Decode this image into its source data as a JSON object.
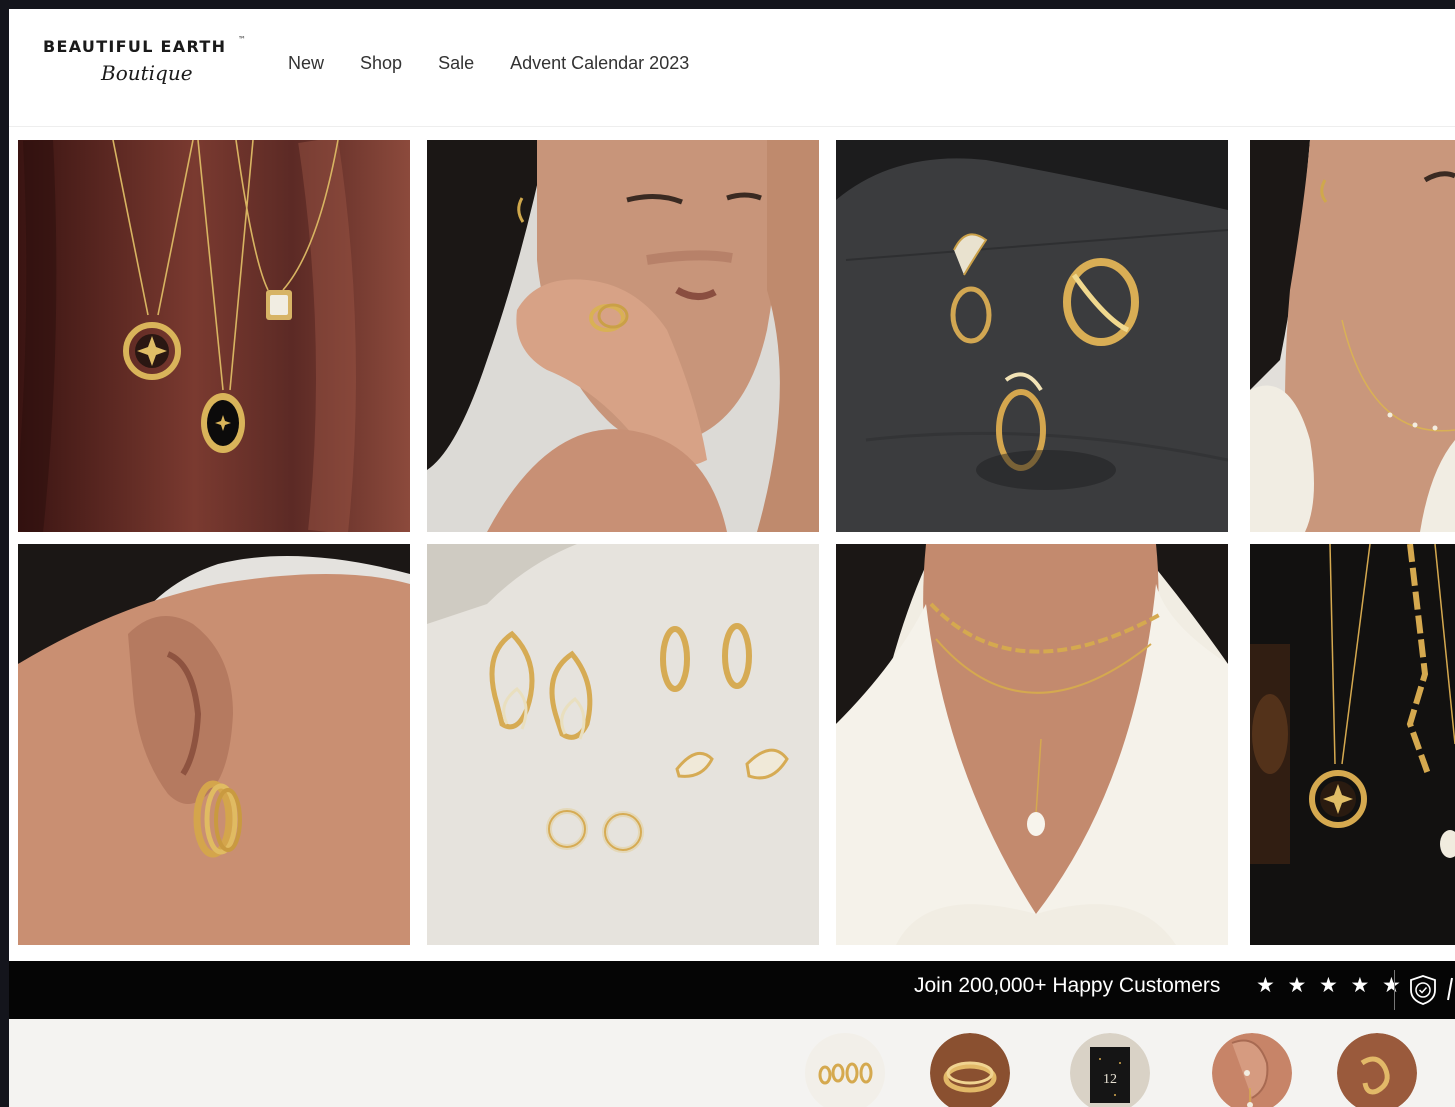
{
  "brand": {
    "name": "BEAUTIFUL EARTH",
    "trademark": "™",
    "subtitle": "Boutique"
  },
  "nav": {
    "items": [
      "New",
      "Shop",
      "Sale",
      "Advent Calendar 2023"
    ]
  },
  "gallery": {
    "tiles": [
      "necklaces-on-burgundy",
      "model-with-ring",
      "rings-on-slate",
      "model-necklace-partial",
      "model-hoop-earring",
      "earrings-on-cream",
      "model-layered-necklace",
      "necklaces-on-dark-partial"
    ]
  },
  "banner": {
    "text": "Join 200,000+ Happy Customers",
    "stars": "★ ★ ★ ★ ★",
    "rating": 5,
    "icon": "shield-check-icon"
  },
  "categories": [
    "earrings-thumb",
    "rings-thumb",
    "advent-calendar-thumb",
    "ear-cuff-thumb",
    "wave-ring-thumb"
  ],
  "colors": {
    "banner_bg": "#050505",
    "gold": "#c9a14a",
    "page_bg": "#ffffff",
    "frame": "#14151c"
  }
}
